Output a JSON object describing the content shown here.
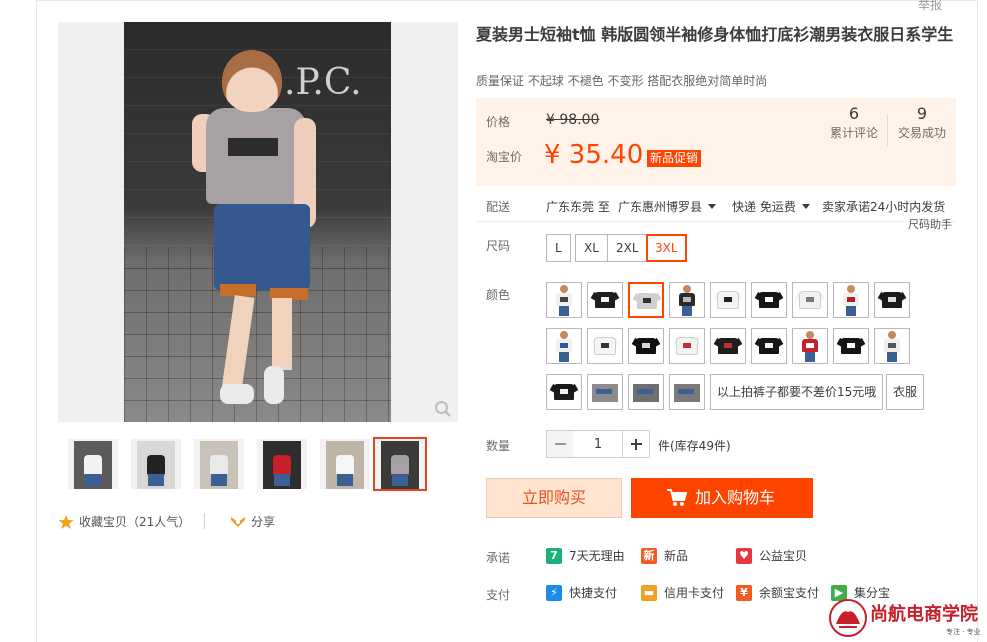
{
  "header": {
    "report_label": "举报"
  },
  "gallery": {
    "thumbnails": [
      {
        "shirt_color": "#f2f2f2",
        "bg": "#5b5b5b"
      },
      {
        "shirt_color": "#222222",
        "bg": "#d7d7d7"
      },
      {
        "shirt_color": "#e9e9e9",
        "bg": "#c9c2b8"
      },
      {
        "shirt_color": "#c8202a",
        "bg": "#2e2e2e"
      },
      {
        "shirt_color": "#f5f5f5",
        "bg": "#bfb5a7"
      },
      {
        "shirt_color": "#a7a0a5",
        "bg": "#3a3a3a"
      }
    ],
    "active_thumbnail": 5,
    "favorite_text": "收藏宝贝（21人气）",
    "share_text": "分享"
  },
  "product": {
    "title": "夏装男士短袖t恤 韩版圆领半袖修身体恤打底衫潮男装衣服日系学生",
    "subtitle": "质量保证 不起球 不褪色 不变形 搭配衣服绝对简单时尚"
  },
  "price": {
    "price_label": "价格",
    "original_price": "¥ 98.00",
    "taobao_label": "淘宝价",
    "taobao_price": "¥ 35.40",
    "promo_tag": "新品促销",
    "reviews_count": "6",
    "reviews_label": "累计评论",
    "deals_count": "9",
    "deals_label": "交易成功"
  },
  "shipping": {
    "label": "配送",
    "from": "广东东莞 至",
    "to": "广东惠州博罗县",
    "method": "快递 免运费",
    "promise": "卖家承诺24小时内发货",
    "size_helper": "尺码助手"
  },
  "sizes": {
    "label": "尺码",
    "options": [
      "L",
      "XL",
      "2XL",
      "3XL"
    ],
    "selected_index": 3
  },
  "colors": {
    "label": "颜色",
    "swatches": [
      {
        "icon": "white-tee-model-icon",
        "shirt": "#f1f1f1",
        "mark": "#444444"
      },
      {
        "icon": "black-tee-icon",
        "shirt": "#1d1d1d",
        "mark": "#f4f4f4"
      },
      {
        "icon": "grey-tee-print-icon",
        "shirt": "#cfcfcf",
        "mark": "#333333"
      },
      {
        "icon": "black-tee-model-icon",
        "shirt": "#2a2a2a",
        "mark": "#bbbbbb"
      },
      {
        "icon": "white-tee-icon",
        "shirt": "#f4f4f4",
        "mark": "#222222"
      },
      {
        "icon": "black-tee-icon",
        "shirt": "#161616",
        "mark": "#ffffff"
      },
      {
        "icon": "white-tee-icon",
        "shirt": "#f0f0f0",
        "mark": "#7a7a7a"
      },
      {
        "icon": "white-tee-model-icon",
        "shirt": "#efefef",
        "mark": "#b02020"
      },
      {
        "icon": "black-tee-icon",
        "shirt": "#1b1b1b",
        "mark": "#e0e0e0"
      },
      {
        "icon": "white-tee-model-icon",
        "shirt": "#f0f0f0",
        "mark": "#2f5aa0"
      },
      {
        "icon": "white-tee-icon",
        "shirt": "#f5f5f5",
        "mark": "#333333"
      },
      {
        "icon": "black-tee-icon",
        "shirt": "#111111",
        "mark": "#d8d8d8"
      },
      {
        "icon": "white-tee-icon",
        "shirt": "#f2f2f2",
        "mark": "#c03030"
      },
      {
        "icon": "black-tee-icon",
        "shirt": "#1e1e1e",
        "mark": "#c03030"
      },
      {
        "icon": "black-tee-icon",
        "shirt": "#161616",
        "mark": "#f0f0f0"
      },
      {
        "icon": "red-tee-model-icon",
        "shirt": "#c8202a",
        "mark": "#ffffff"
      },
      {
        "icon": "black-tee-icon",
        "shirt": "#151515",
        "mark": "#ffffff"
      },
      {
        "icon": "white-tee-model-icon",
        "shirt": "#eeeeee",
        "mark": "#555555"
      },
      {
        "icon": "black-tee-icon",
        "shirt": "#1a1a1a",
        "mark": "#f2f2f2"
      },
      {
        "icon": "shorts-model-icon",
        "shirt": "#8c8c8c",
        "mark": "#3d6094"
      },
      {
        "icon": "shorts-model-icon",
        "shirt": "#6f6f6f",
        "mark": "#3d6094"
      },
      {
        "icon": "shorts-model-icon",
        "shirt": "#7a7a7a",
        "mark": "#3d6094"
      }
    ],
    "selected_index": 2,
    "text_options": [
      "以上拍裤子都要不差价15元哦",
      "衣服"
    ]
  },
  "quantity": {
    "label": "数量",
    "value": "1",
    "stock_text": "件(库存49件)"
  },
  "actions": {
    "buy_now": "立即购买",
    "add_to_cart": "加入购物车"
  },
  "promises": {
    "label": "承诺",
    "items": [
      {
        "icon": "seven-days-icon",
        "text": "7天无理由",
        "color": "#17b37a",
        "glyph": "7"
      },
      {
        "icon": "new-product-icon",
        "text": "新品",
        "color": "#f15a22",
        "glyph": "新"
      },
      {
        "icon": "charity-icon",
        "text": "公益宝贝",
        "color": "#e8373d",
        "glyph": "♥"
      }
    ]
  },
  "payment": {
    "label": "支付",
    "items": [
      {
        "icon": "quick-pay-icon",
        "text": "快捷支付",
        "color": "#1a8ce8",
        "glyph": "⚡"
      },
      {
        "icon": "credit-card-icon",
        "text": "信用卡支付",
        "color": "#f4a024",
        "glyph": "▬"
      },
      {
        "icon": "yuebao-icon",
        "text": "余额宝支付",
        "color": "#f15a22",
        "glyph": "¥"
      },
      {
        "icon": "jifenbao-icon",
        "text": "集分宝",
        "color": "#3fae49",
        "glyph": "▶"
      }
    ]
  },
  "colors_theme": {
    "accent": "#ff4400",
    "price_bg": "#fff2e8"
  },
  "watermark": {
    "logo_text": "尚航电商学院",
    "tagline": "专注 · 专业"
  }
}
